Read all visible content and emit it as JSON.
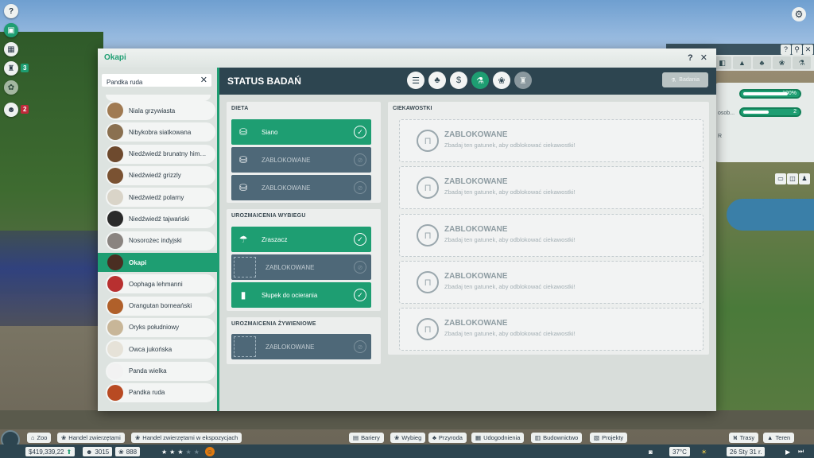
{
  "hud": {
    "left_icons": [
      {
        "icon": "help-icon",
        "glyph": "?"
      },
      {
        "icon": "map-icon",
        "glyph": "▣"
      },
      {
        "icon": "calendar-icon",
        "glyph": "▦"
      },
      {
        "icon": "trophy-icon",
        "glyph": "♜",
        "badge": "3"
      },
      {
        "icon": "gear-icon",
        "glyph": "✿"
      },
      {
        "icon": "worker-icon",
        "glyph": "☻",
        "badge": "2"
      }
    ]
  },
  "bg_panel": {
    "bar1_text": "100%",
    "bar1_level": 1.0,
    "bar2_text": "2",
    "bar2_level": 0.8,
    "osob_text": "osob...",
    "r_text": "R"
  },
  "window": {
    "title": "Okapi",
    "controls": "? ✕"
  },
  "search": {
    "value": "Pandka ruda",
    "clear": "✕"
  },
  "species": [
    {
      "name": "Niala grzywiasta",
      "color": "#a07a52"
    },
    {
      "name": "Nibykobra siatkowana",
      "color": "#8a7050"
    },
    {
      "name": "Niedźwiedź brunatny himal...",
      "color": "#6e4a2e"
    },
    {
      "name": "Niedźwiedź grizzly",
      "color": "#7a5232"
    },
    {
      "name": "Niedźwiedź polarny",
      "color": "#d9d4c8"
    },
    {
      "name": "Niedźwiedź tajwański",
      "color": "#2a2a2a"
    },
    {
      "name": "Nosorożec indyjski",
      "color": "#8a8480"
    },
    {
      "name": "Okapi",
      "color": "#4a2e22",
      "active": true
    },
    {
      "name": "Oophaga lehmanni",
      "color": "#b83030"
    },
    {
      "name": "Orangutan borneański",
      "color": "#b0602a"
    },
    {
      "name": "Oryks południowy",
      "color": "#c8b698"
    },
    {
      "name": "Owca jukońska",
      "color": "#e6e2d8"
    },
    {
      "name": "Panda wielka",
      "color": "#f2f2f2"
    },
    {
      "name": "Pandka ruda",
      "color": "#b84a22"
    }
  ],
  "header": {
    "title": "STATUS BADAŃ",
    "research_button": "Badania",
    "categories": [
      {
        "icon": "clipboard-icon",
        "glyph": "☰",
        "state": "normal"
      },
      {
        "icon": "tree-icon",
        "glyph": "♣",
        "state": "normal"
      },
      {
        "icon": "money-bag-icon",
        "glyph": "$",
        "state": "normal"
      },
      {
        "icon": "flask-icon",
        "glyph": "⚗",
        "state": "on"
      },
      {
        "icon": "paw-icon",
        "glyph": "❀",
        "state": "normal"
      },
      {
        "icon": "trophy-icon",
        "glyph": "♜",
        "state": "off"
      }
    ]
  },
  "diet": {
    "heading": "DIETA",
    "items": [
      {
        "label": "Siano",
        "state": "unlocked",
        "icon": "food-bowl-icon",
        "glyph": "⛁"
      },
      {
        "label": "ZABLOKOWANE",
        "state": "locked",
        "icon": "food-bowl-icon",
        "glyph": "⛁"
      },
      {
        "label": "ZABLOKOWANE",
        "state": "locked",
        "icon": "food-bowl-icon",
        "glyph": "⛁"
      }
    ]
  },
  "habitat_enrichment": {
    "heading": "UROZMAICENIA WYBIEGU",
    "items": [
      {
        "label": "Zraszacz",
        "state": "unlocked",
        "icon": "sprinkler-icon",
        "glyph": "☂"
      },
      {
        "label": "ZABLOKOWANE",
        "state": "locked",
        "icon": "empty-slot-icon",
        "glyph": ""
      },
      {
        "label": "Słupek do ocierania",
        "state": "unlocked",
        "icon": "scratching-post-icon",
        "glyph": "▮"
      }
    ]
  },
  "food_enrichment": {
    "heading": "UROZMAICENIA ŻYWIENIOWE",
    "items": [
      {
        "label": "ZABLOKOWANE",
        "state": "locked",
        "icon": "empty-slot-icon",
        "glyph": ""
      }
    ]
  },
  "trivia": {
    "heading": "CIEKAWOSTKI",
    "cards": [
      {
        "title": "ZABLOKOWANE",
        "desc": "Zbadaj ten gatunek, aby odblokować ciekawostki!"
      },
      {
        "title": "ZABLOKOWANE",
        "desc": "Zbadaj ten gatunek, aby odblokować ciekawostki!"
      },
      {
        "title": "ZABLOKOWANE",
        "desc": "Zbadaj ten gatunek, aby odblokować ciekawostki!"
      },
      {
        "title": "ZABLOKOWANE",
        "desc": "Zbadaj ten gatunek, aby odblokować ciekawostki!"
      },
      {
        "title": "ZABLOKOWANE",
        "desc": "Zbadaj ten gatunek, aby odblokować ciekawostki!"
      }
    ]
  },
  "bottom_bar": {
    "left_buttons": [
      "Zoo",
      "Handel zwierzętami",
      "Handel zwierzętami w ekspozycjach"
    ],
    "center_buttons": [
      "Bariery",
      "Wybieg",
      "Przyroda",
      "Udogodnienia",
      "Budownictwo",
      "Projekty"
    ],
    "right_buttons": [
      "Trasy",
      "Teren"
    ],
    "money": "$419,339,22",
    "guests": "3015",
    "animals": "888",
    "rating_stars": 3,
    "temperature": "37°C",
    "date": "26 Sty 31 r."
  }
}
